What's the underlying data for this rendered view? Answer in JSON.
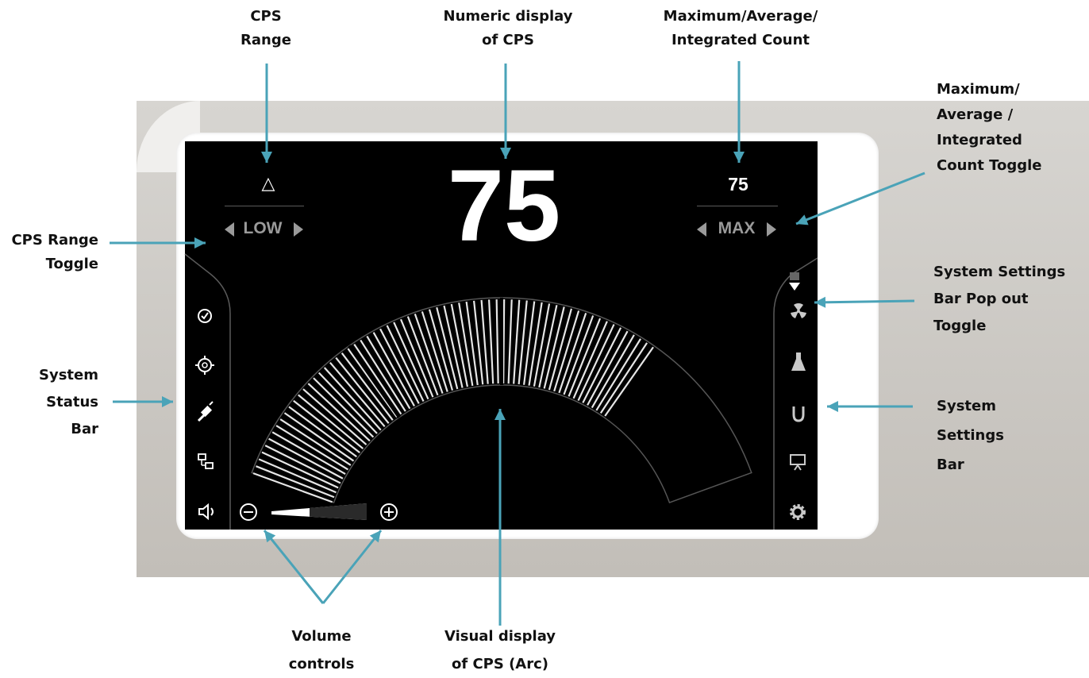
{
  "device": {
    "cps_value": "75",
    "range_symbol": "△",
    "range_label": "LOW",
    "stat_value": "75",
    "stat_label": "MAX",
    "arc_fill_fraction": 0.75
  },
  "status_bar_icons": [
    "check-circle-icon",
    "crosshair-icon",
    "plug-icon",
    "network-icon",
    "speaker-icon"
  ],
  "settings_bar_icons": [
    "popout-tab-icon",
    "radiation-icon",
    "flask-icon",
    "magnet-icon",
    "monitor-icon",
    "gear-icon"
  ],
  "volume": {
    "minus": "−",
    "plus": "+",
    "level": 0.4
  },
  "colors": {
    "arrow": "#4aa3b8",
    "screen": "#000000",
    "bezel": "#cbc8c3"
  },
  "callouts": {
    "cps_range": [
      "CPS",
      "Range"
    ],
    "numeric_display": [
      "Numeric display",
      "of CPS"
    ],
    "max_avg_count": [
      "Maximum/Average/",
      "Integrated Count"
    ],
    "max_avg_toggle": [
      "Maximum/",
      "Average /",
      "Integrated",
      "Count Toggle"
    ],
    "cps_range_toggle": [
      "CPS Range",
      "Toggle"
    ],
    "settings_popout": [
      "System Settings",
      "Bar Pop out",
      "Toggle"
    ],
    "status_bar": [
      "System",
      "Status",
      "Bar"
    ],
    "settings_bar": [
      "System",
      "Settings",
      "Bar"
    ],
    "volume_controls": [
      "Volume",
      "controls"
    ],
    "visual_display": [
      "Visual display",
      "of CPS (Arc)"
    ]
  }
}
